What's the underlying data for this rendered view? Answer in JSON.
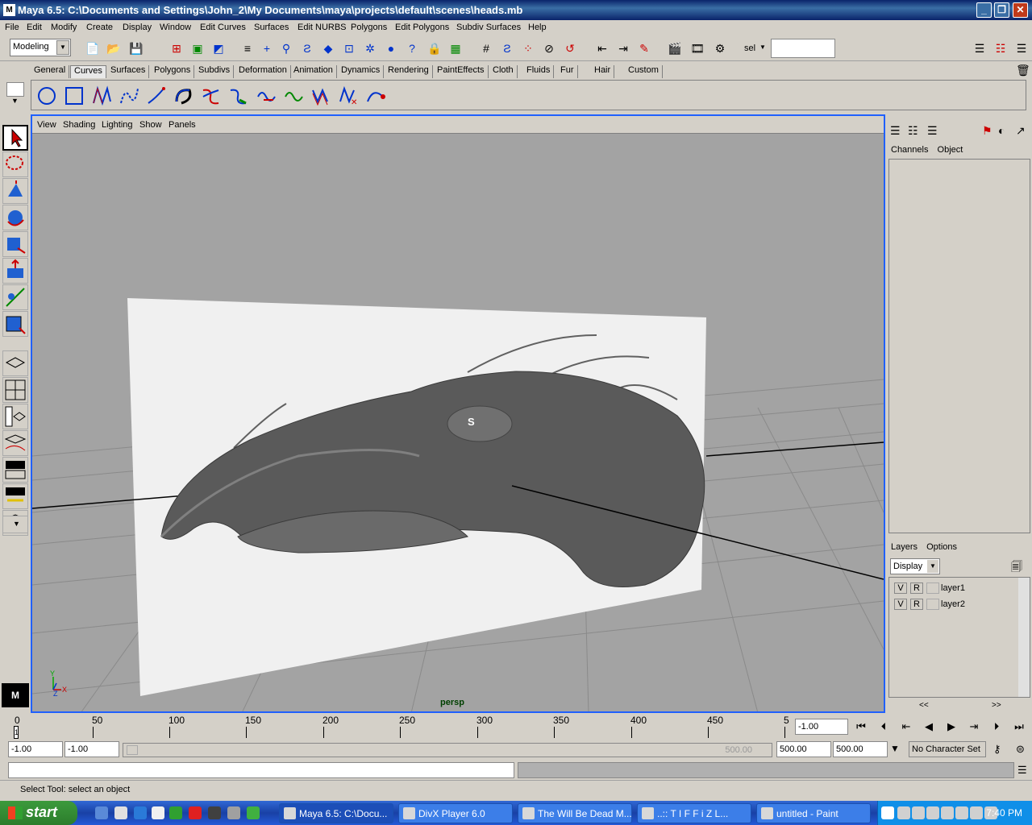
{
  "window": {
    "title": "Maya 6.5: C:\\Documents and Settings\\John_2\\My Documents\\maya\\projects\\default\\scenes\\heads.mb"
  },
  "menu": [
    "File",
    "Edit",
    "Modify",
    "Create",
    "Display",
    "Window",
    "Edit Curves",
    "Surfaces",
    "Edit NURBS",
    "Polygons",
    "Edit Polygons",
    "Subdiv Surfaces",
    "Help"
  ],
  "mode_selector": {
    "value": "Modeling"
  },
  "sel_label": "sel",
  "shelf_tabs": [
    "General",
    "Curves",
    "Surfaces",
    "Polygons",
    "Subdivs",
    "Deformation",
    "Animation",
    "Dynamics",
    "Rendering",
    "PaintEffects",
    "Cloth",
    "Fluids",
    "Fur",
    "Hair",
    "Custom"
  ],
  "active_shelf_tab": "Curves",
  "viewport": {
    "menu": [
      "View",
      "Shading",
      "Lighting",
      "Show",
      "Panels"
    ],
    "camera_label": "persp",
    "axis_labels": {
      "x": "X",
      "y": "Y",
      "z": "Z"
    },
    "eye_label": "S"
  },
  "channel_box": {
    "tabs": [
      "Channels",
      "Object"
    ]
  },
  "layers": {
    "menu": [
      "Layers",
      "Options"
    ],
    "display_mode": "Display",
    "items": [
      {
        "v": "V",
        "r": "R",
        "name": "layer1"
      },
      {
        "v": "V",
        "r": "R",
        "name": "layer2"
      }
    ],
    "scroll_left": "<<",
    "scroll_right": ">>"
  },
  "timeline": {
    "ticks": [
      "0",
      "50",
      "100",
      "150",
      "200",
      "250",
      "300",
      "350",
      "400",
      "450",
      "5"
    ],
    "current_frame": "-1.00",
    "current_frame_marker": "1"
  },
  "range": {
    "start": "-1.00",
    "playback_start": "-1.00",
    "slider_label": "500.00",
    "playback_end": "500.00",
    "end": "500.00",
    "character_set": "No Character Set"
  },
  "help_line": "Select Tool: select an object",
  "taskbar": {
    "start_label": "start",
    "tasks": [
      {
        "label": "Maya 6.5: C:\\Docu...",
        "active": true
      },
      {
        "label": "DivX Player 6.0",
        "active": false
      },
      {
        "label": "The Will Be Dead M...",
        "active": false
      },
      {
        "label": "..:: T I F F i Z L...",
        "active": false
      },
      {
        "label": "untitled - Paint",
        "active": false
      }
    ],
    "clock": "7:40 PM"
  },
  "colors": {
    "accent": "#2060ff",
    "titlebar": "#0a246a",
    "taskbar": "#245ad8"
  }
}
